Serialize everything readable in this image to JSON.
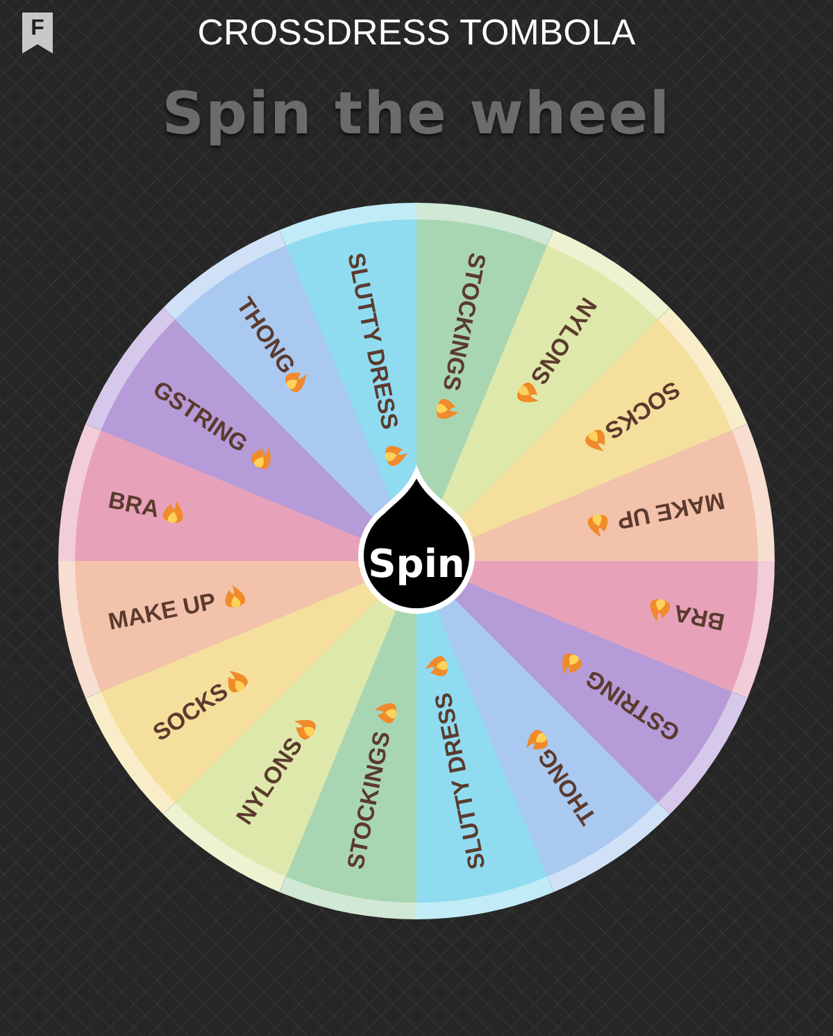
{
  "header": {
    "badge": "F",
    "title": "CROSSDRESS TOMBOLA"
  },
  "heading": "Spin the wheel",
  "wheel": {
    "segments": [
      {
        "label": "STOCKINGS",
        "color": "#a9d6b2"
      },
      {
        "label": "NYLONS",
        "color": "#dfe8ab"
      },
      {
        "label": "SOCKS",
        "color": "#f4df9c"
      },
      {
        "label": "MAKE UP",
        "color": "#f3c2ab"
      },
      {
        "label": "BRA",
        "color": "#e7a2ba"
      },
      {
        "label": "GSTRING",
        "color": "#b59bd8"
      },
      {
        "label": "THONG",
        "color": "#a9c9f0"
      },
      {
        "label": "SLUTTY DRESS",
        "color": "#8fdcf0"
      },
      {
        "label": "STOCKINGS",
        "color": "#a9d6b2"
      },
      {
        "label": "NYLONS",
        "color": "#dfe8ab"
      },
      {
        "label": "SOCKS",
        "color": "#f4df9c"
      },
      {
        "label": "MAKE UP",
        "color": "#f3c2ab"
      },
      {
        "label": "BRA",
        "color": "#e7a2ba"
      },
      {
        "label": "GSTRING",
        "color": "#b59bd8"
      },
      {
        "label": "THONG",
        "color": "#a9c9f0"
      },
      {
        "label": "SLUTTY DRESS",
        "color": "#8fdcf0"
      }
    ],
    "spin_label": "Spin"
  }
}
